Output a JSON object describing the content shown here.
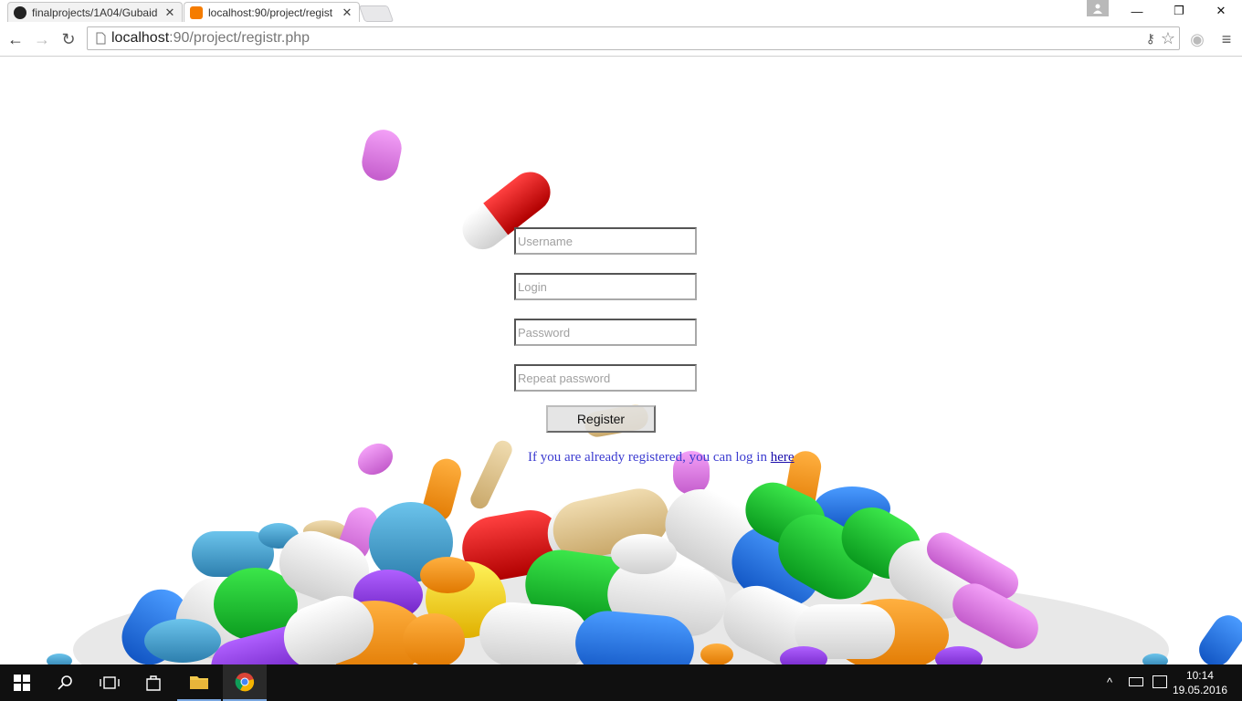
{
  "browser": {
    "tabs": [
      {
        "label": "finalprojects/1A04/Gubaid",
        "active": false
      },
      {
        "label": "localhost:90/project/regist",
        "active": true
      }
    ],
    "url_host": "localhost",
    "url_path": ":90/project/registr.php"
  },
  "form": {
    "username_placeholder": "Username",
    "login_placeholder": "Login",
    "password_placeholder": "Password",
    "repeat_password_placeholder": "Repeat password",
    "register_label": "Register",
    "already_text": "If you are already registered, you can log in ",
    "here_link": "here"
  },
  "taskbar": {
    "time": "10:14",
    "date": "19.05.2016"
  },
  "colors": {
    "link": "#1a0dab",
    "taskbar": "#101010",
    "chrome_accent": "#4285f4"
  }
}
